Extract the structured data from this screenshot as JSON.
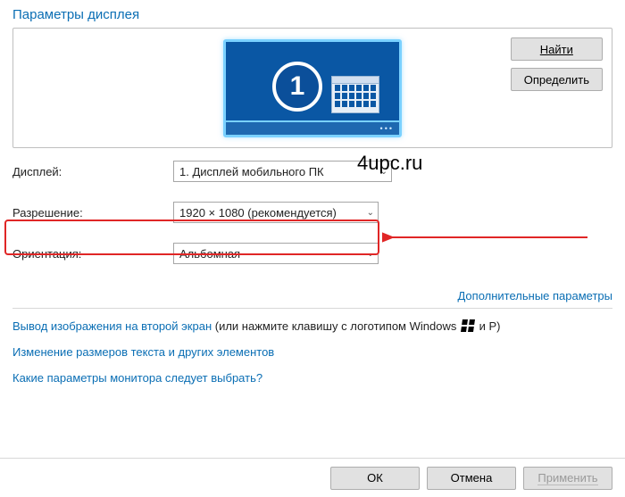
{
  "title": "Параметры дисплея",
  "identify_panel": {
    "find_btn": "Найти",
    "detect_btn": "Определить",
    "monitor_number": "1"
  },
  "watermark": "4upc.ru",
  "rows": {
    "display_label": "Дисплей:",
    "display_value": "1. Дисплей мобильного ПК",
    "resolution_label": "Разрешение:",
    "resolution_value": "1920 × 1080 (рекомендуется)",
    "orientation_label": "Ориентация:",
    "orientation_value": "Альбомная"
  },
  "advanced_link": "Дополнительные параметры",
  "help": {
    "line1_link": "Вывод изображения на второй экран",
    "line1_plain_a": " (или нажмите клавишу с логотипом Windows ",
    "line1_plain_b": " и P)",
    "line2": "Изменение размеров текста и других элементов",
    "line3": "Какие параметры монитора следует выбрать?"
  },
  "footer": {
    "ok": "ОК",
    "cancel": "Отмена",
    "apply": "Применить"
  }
}
